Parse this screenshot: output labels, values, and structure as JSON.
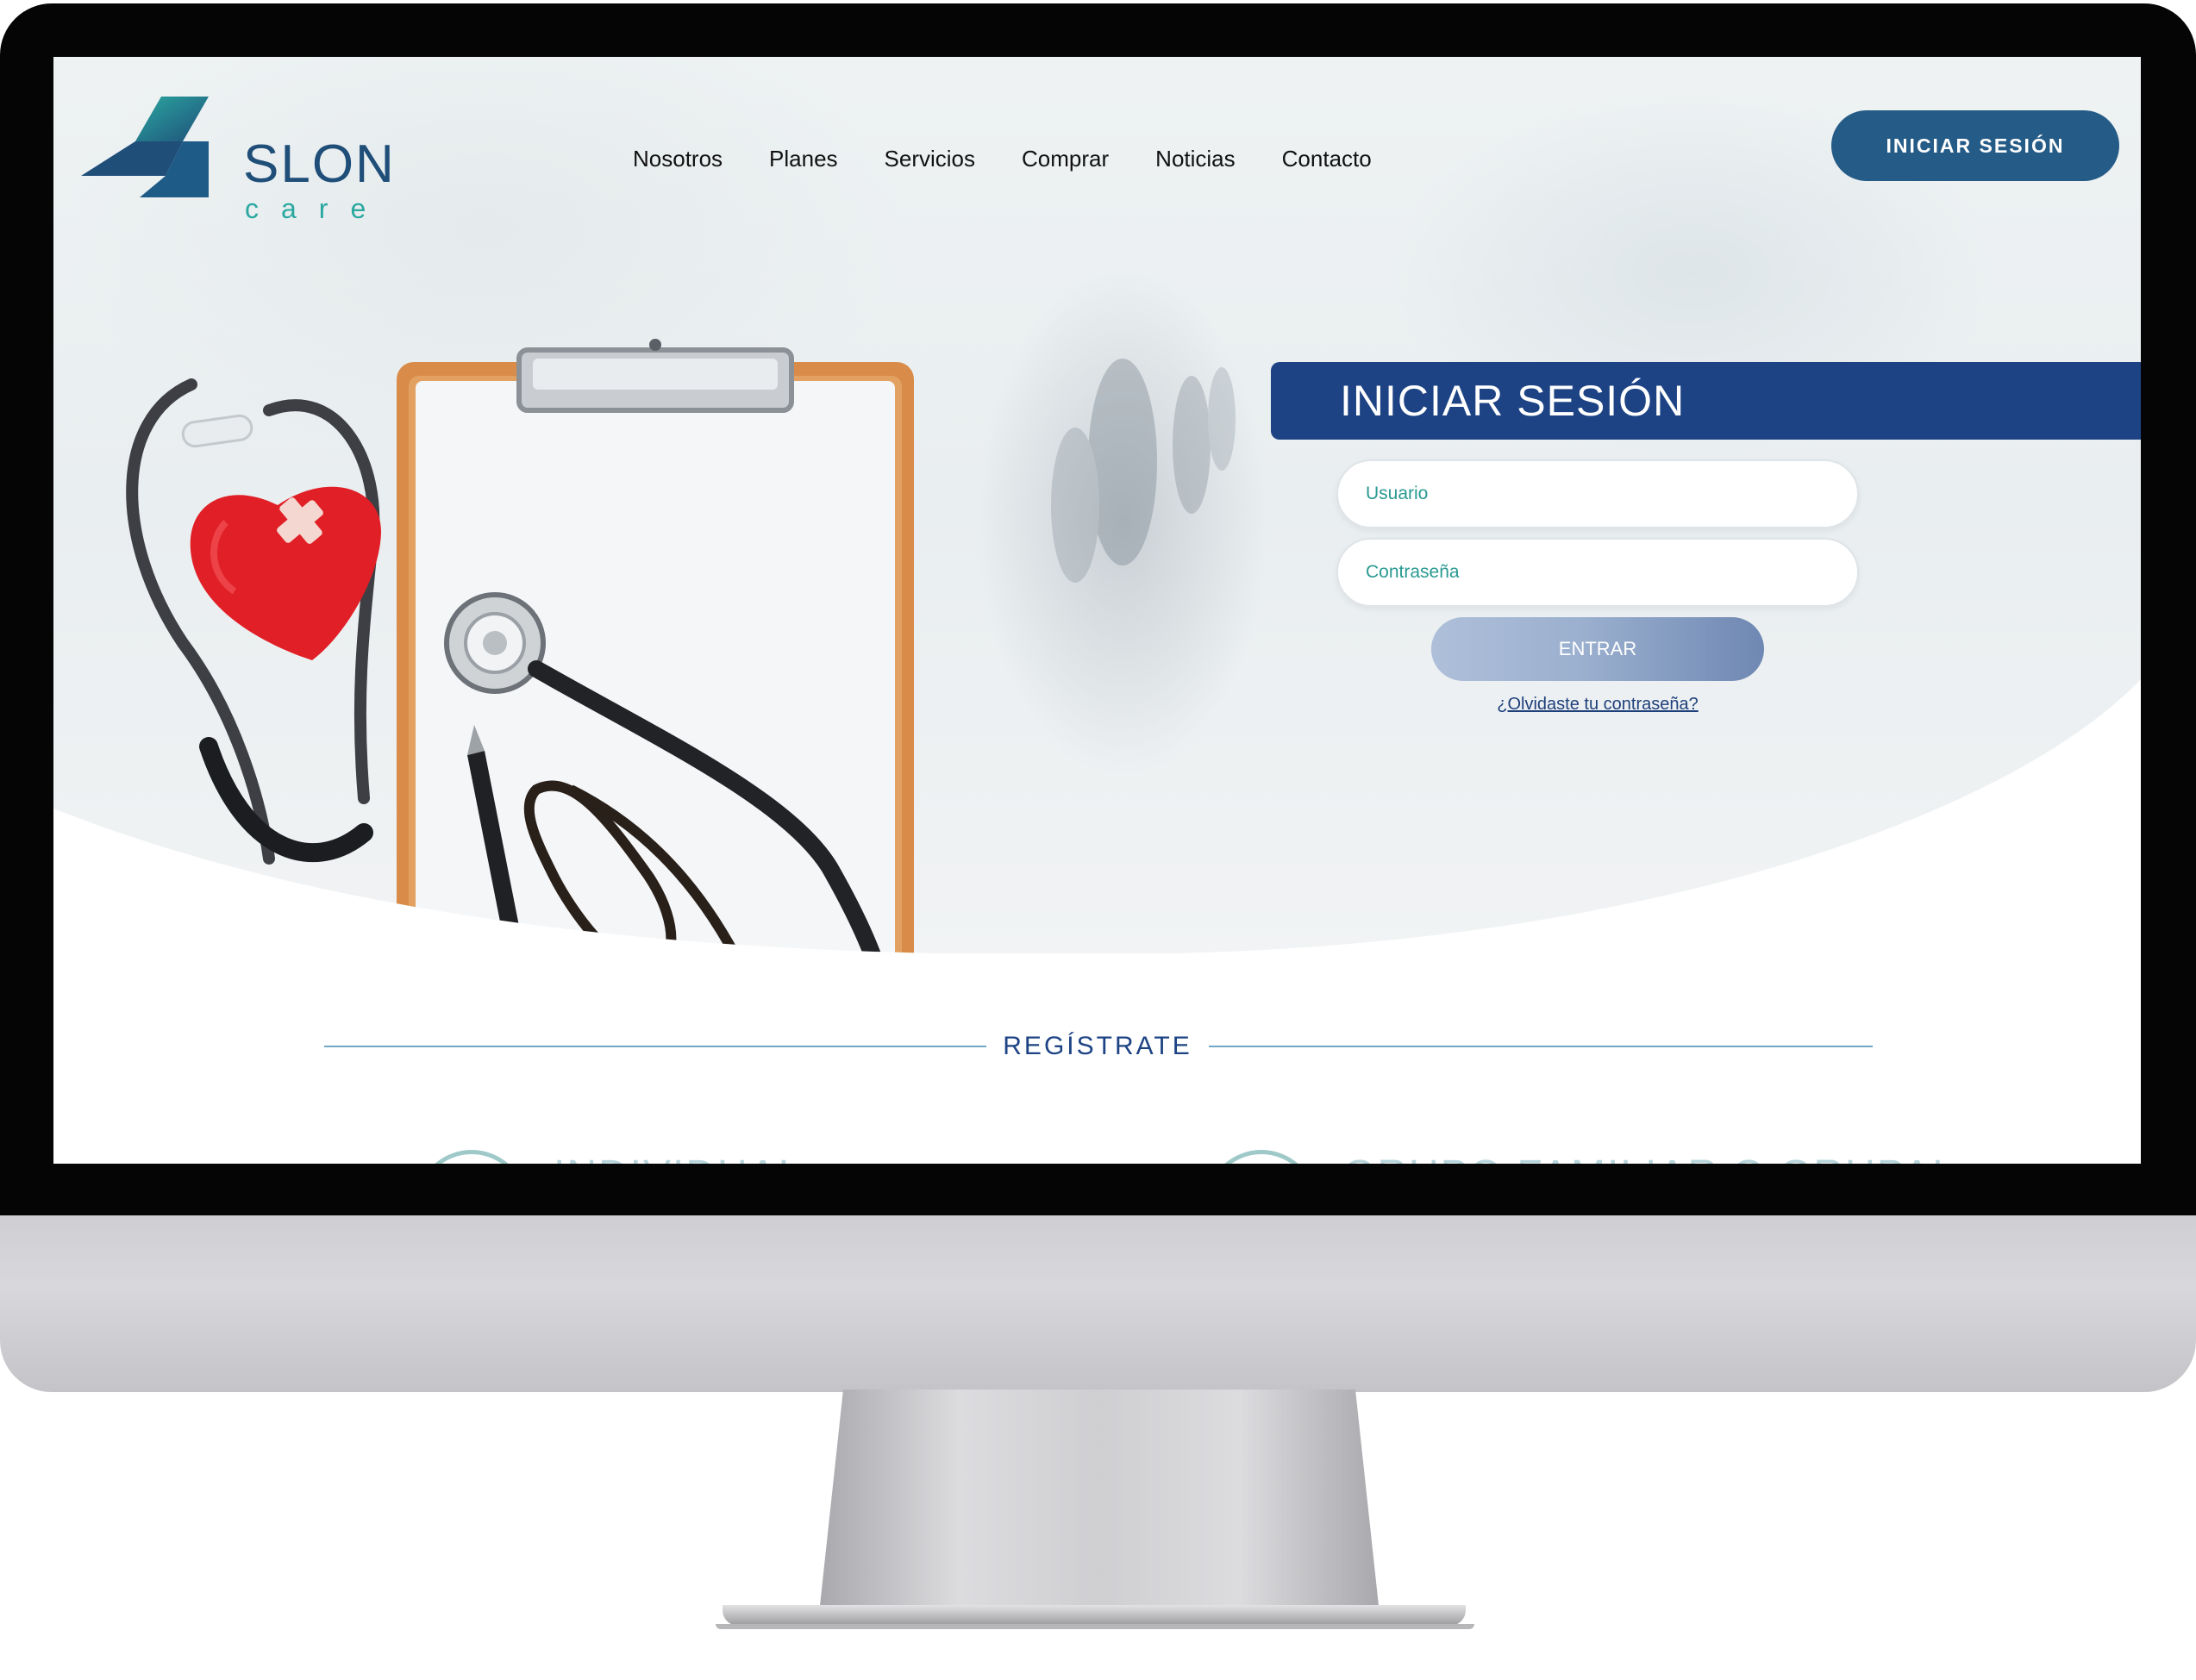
{
  "brand": {
    "name": "SLON",
    "tagline": "care"
  },
  "nav": {
    "items": [
      {
        "label": "Nosotros"
      },
      {
        "label": "Planes"
      },
      {
        "label": "Servicios"
      },
      {
        "label": "Comprar"
      },
      {
        "label": "Noticias"
      },
      {
        "label": "Contacto"
      }
    ],
    "login_button": "INICIAR SESIÓN"
  },
  "login": {
    "title": "INICIAR SESIÓN",
    "username_placeholder": "Usuario",
    "password_placeholder": "Contraseña",
    "submit_label": "ENTRAR",
    "forgot_link": "¿Olvidaste tu contraseña?"
  },
  "register": {
    "title": "REGÍSTRATE",
    "options": [
      {
        "label": "INDIVIDUAL"
      },
      {
        "label": "GRUPO FAMILIAR O GRUPAL"
      }
    ]
  },
  "colors": {
    "primary": "#1d4384",
    "header_button": "#255b87",
    "accent_teal": "#2aa8a0",
    "register_line": "#6fa9c4"
  },
  "icons": {
    "logo": "slon-care-logo",
    "hero": "medical-clipboard-stethoscope-photo"
  }
}
